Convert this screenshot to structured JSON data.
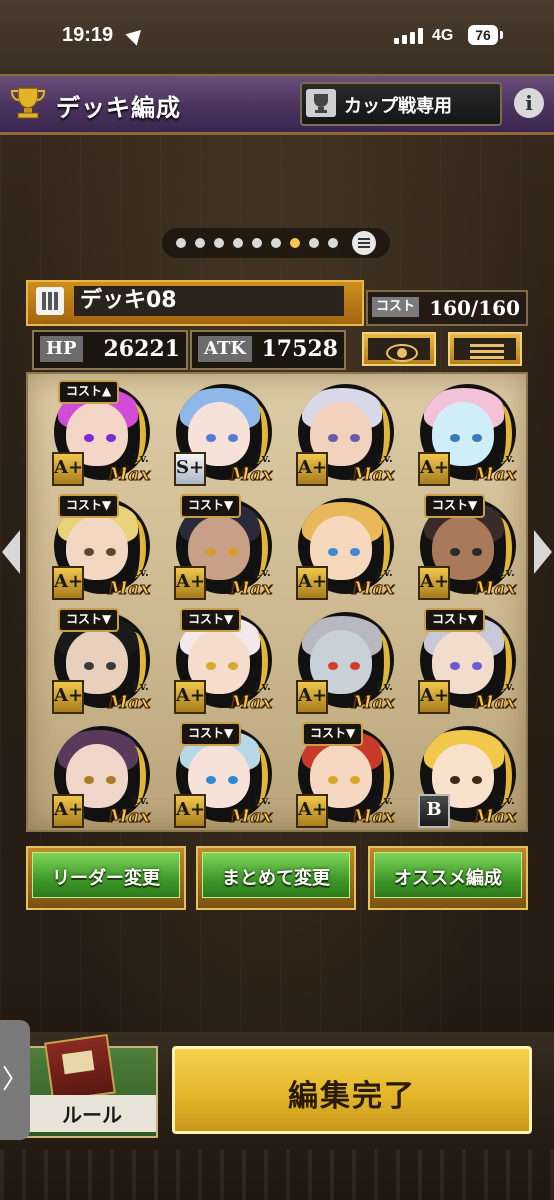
{
  "status": {
    "time": "19:19",
    "network": "4G",
    "battery": "76"
  },
  "header": {
    "title": "デッキ編成",
    "cup_label": "カップ戦専用",
    "info_label": "i"
  },
  "deck": {
    "name": "デッキ08",
    "cost_label": "コスト",
    "cost_value": "160/160",
    "hp_label": "HP",
    "hp_value": "26221",
    "atk_label": "ATK",
    "atk_value": "17528"
  },
  "cards": [
    {
      "rank": "A+",
      "cost_badge": "コスト▲",
      "lv": "Lv.",
      "max": "Max",
      "hair": "#d24bd6",
      "skin": "#f4d6c8",
      "eye": "#7a2ad6"
    },
    {
      "rank": "S+",
      "cost_badge": "",
      "lv": "Lv.",
      "max": "Max",
      "hair": "#8fb8e8",
      "skin": "#f6e2d8",
      "eye": "#5a7ad8"
    },
    {
      "rank": "A+",
      "cost_badge": "",
      "lv": "Lv.",
      "max": "Max",
      "hair": "#d8d8e8",
      "skin": "#f2d2bc",
      "eye": "#6a5aa8"
    },
    {
      "rank": "A+",
      "cost_badge": "",
      "lv": "Lv.",
      "max": "Max",
      "hair": "#f4c2d8",
      "skin": "#cfeef8",
      "eye": "#3a7ab8"
    },
    {
      "rank": "A+",
      "cost_badge": "コスト▼",
      "lv": "Lv.",
      "max": "Max",
      "hair": "#e8d27a",
      "skin": "#f2d8c2",
      "eye": "#5a4a2a"
    },
    {
      "rank": "A+",
      "cost_badge": "コスト▼",
      "lv": "Lv.",
      "max": "Max",
      "hair": "#2a2a3a",
      "skin": "#c8a088",
      "eye": "#d89a2a"
    },
    {
      "rank": "A+",
      "cost_badge": "",
      "lv": "Lv.",
      "max": "Max",
      "hair": "#e8b85a",
      "skin": "#f6d8bc",
      "eye": "#3a8ad8"
    },
    {
      "rank": "A+",
      "cost_badge": "コスト▼",
      "lv": "Lv.",
      "max": "Max",
      "hair": "#3a2a2a",
      "skin": "#a87a5a",
      "eye": "#2a2a2a"
    },
    {
      "rank": "A+",
      "cost_badge": "コスト▼",
      "lv": "Lv.",
      "max": "Max",
      "hair": "#1a1a1a",
      "skin": "#e8d0bc",
      "eye": "#3a3a3a"
    },
    {
      "rank": "A+",
      "cost_badge": "コスト▼",
      "lv": "Lv.",
      "max": "Max",
      "hair": "#f4e8ea",
      "skin": "#f6dccc",
      "eye": "#d8a82a"
    },
    {
      "rank": "A+",
      "cost_badge": "",
      "lv": "Lv.",
      "max": "Max",
      "hair": "#b8b8c0",
      "skin": "#c8d0d8",
      "eye": "#d83a2a"
    },
    {
      "rank": "A+",
      "cost_badge": "コスト▼",
      "lv": "Lv.",
      "max": "Max",
      "hair": "#c8c8d8",
      "skin": "#f2dccc",
      "eye": "#6a5ad8"
    },
    {
      "rank": "A+",
      "cost_badge": "",
      "lv": "Lv.",
      "max": "Max",
      "hair": "#5a3a5a",
      "skin": "#f0d6c8",
      "eye": "#a87a2a"
    },
    {
      "rank": "A+",
      "cost_badge": "コスト▼",
      "lv": "Lv.",
      "max": "Max",
      "hair": "#b8d8e8",
      "skin": "#f6e2d8",
      "eye": "#2a8ad8"
    },
    {
      "rank": "A+",
      "cost_badge": "コスト▼",
      "lv": "Lv.",
      "max": "Max",
      "hair": "#c83a2a",
      "skin": "#f6d8c2",
      "eye": "#d8a82a"
    },
    {
      "rank": "B",
      "cost_badge": "",
      "lv": "Lv.",
      "max": "Max",
      "hair": "#f2c84a",
      "skin": "#f8e2cc",
      "eye": "#3a2a1a"
    }
  ],
  "actions": {
    "leader_change": "リーダー変更",
    "bulk_change": "まとめて変更",
    "recommended": "オススメ編成"
  },
  "bottom": {
    "rule_label": "ルール",
    "done_label": "編集完了",
    "edge_tab": "〉"
  },
  "pager": {
    "pages": 9,
    "active_index": 6
  },
  "colors": {
    "accent_gold": "#e2b428",
    "green": "#3f9a2a",
    "header_purple": "#4c3560"
  }
}
